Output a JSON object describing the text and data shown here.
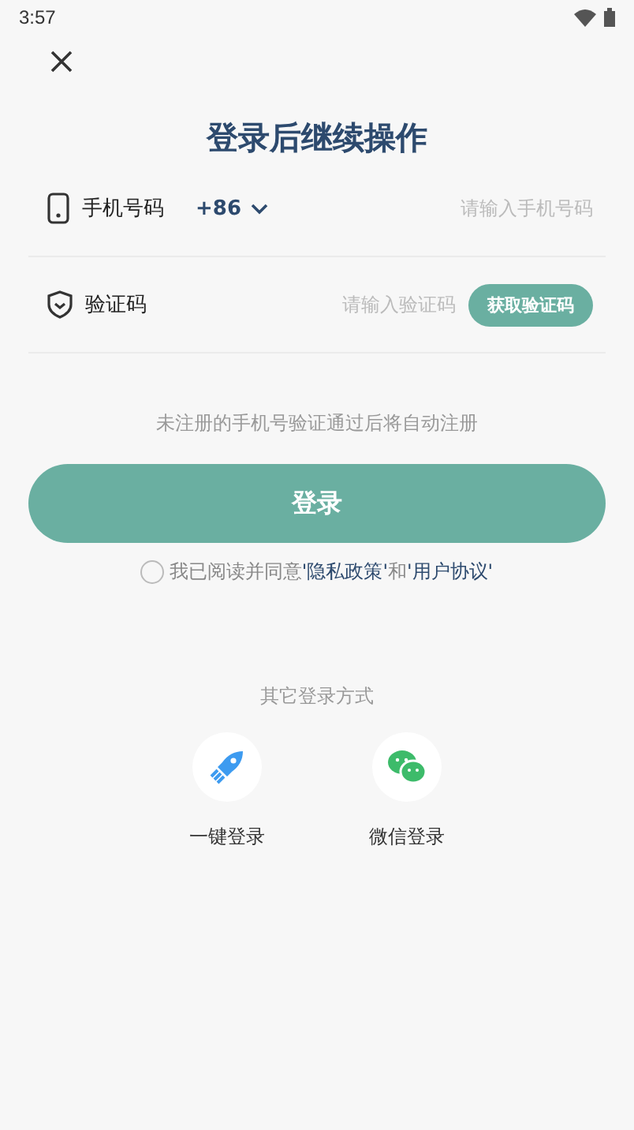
{
  "status_bar": {
    "time": "3:57"
  },
  "title": "登录后继续操作",
  "phone": {
    "label": "手机号码",
    "country_code": "+86",
    "placeholder": "请输入手机号码"
  },
  "code": {
    "label": "验证码",
    "placeholder": "请输入验证码",
    "button": "获取验证码"
  },
  "hint": "未注册的手机号验证通过后将自动注册",
  "login_button": "登录",
  "agreement": {
    "checked": false,
    "parts": [
      {
        "kind": "text",
        "text": "我已阅读并同意"
      },
      {
        "kind": "link",
        "text": "'隐私政策'"
      },
      {
        "kind": "text",
        "text": "和"
      },
      {
        "kind": "link",
        "text": "'用户协议'"
      }
    ]
  },
  "other_login": {
    "title": "其它登录方式",
    "options": [
      {
        "kind": "rocket",
        "label": "一键登录"
      },
      {
        "kind": "wechat",
        "label": "微信登录"
      }
    ]
  }
}
